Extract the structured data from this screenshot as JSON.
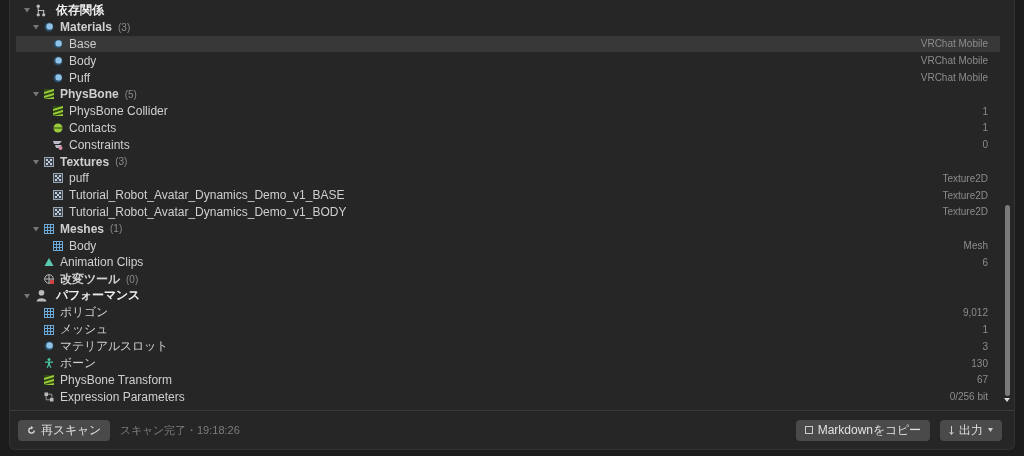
{
  "tree": [
    {
      "kind": "dependency",
      "label": "依存関係",
      "expanded": true,
      "selected": false,
      "children": [
        {
          "kind": "material",
          "label": "Materials",
          "count": "(3)",
          "expanded": true,
          "selected": false,
          "children": [
            {
              "kind": "material",
              "label": "Base",
              "value": "VRChat Mobile",
              "selected": true
            },
            {
              "kind": "material",
              "label": "Body",
              "value": "VRChat Mobile",
              "selected": false
            },
            {
              "kind": "material",
              "label": "Puff",
              "value": "VRChat Mobile",
              "selected": false
            }
          ]
        },
        {
          "kind": "physbone",
          "label": "PhysBone",
          "count": "(5)",
          "expanded": true,
          "selected": false,
          "children": [
            {
              "kind": "physbone",
              "label": "PhysBone Collider",
              "value": "1",
              "selected": false
            },
            {
              "kind": "contact",
              "label": "Contacts",
              "value": "1",
              "selected": false
            },
            {
              "kind": "constraint",
              "label": "Constraints",
              "value": "0",
              "selected": false
            }
          ]
        },
        {
          "kind": "texture",
          "label": "Textures",
          "count": "(3)",
          "expanded": true,
          "selected": false,
          "children": [
            {
              "kind": "texture",
              "label": "puff",
              "value": "Texture2D",
              "selected": false
            },
            {
              "kind": "texture",
              "label": "Tutorial_Robot_Avatar_Dynamics_Demo_v1_BASE",
              "value": "Texture2D",
              "selected": false
            },
            {
              "kind": "texture",
              "label": "Tutorial_Robot_Avatar_Dynamics_Demo_v1_BODY",
              "value": "Texture2D",
              "selected": false
            }
          ]
        },
        {
          "kind": "mesh",
          "label": "Meshes",
          "count": "(1)",
          "expanded": true,
          "selected": false,
          "children": [
            {
              "kind": "mesh",
              "label": "Body",
              "value": "Mesh",
              "selected": false
            }
          ]
        },
        {
          "kind": "animation",
          "label": "Animation Clips",
          "value": "6",
          "selected": false
        },
        {
          "kind": "tool",
          "label": "改変ツール",
          "count": "(0)",
          "selected": false
        }
      ]
    },
    {
      "kind": "performance",
      "label": "パフォーマンス",
      "expanded": true,
      "selected": false,
      "children": [
        {
          "kind": "mesh",
          "label": "ポリゴン",
          "value": "9,012",
          "selected": false
        },
        {
          "kind": "mesh",
          "label": "メッシュ",
          "value": "1",
          "selected": false
        },
        {
          "kind": "material",
          "label": "マテリアルスロット",
          "value": "3",
          "selected": false
        },
        {
          "kind": "bone",
          "label": "ボーン",
          "value": "130",
          "selected": false
        },
        {
          "kind": "physbone",
          "label": "PhysBone Transform",
          "value": "67",
          "selected": false
        },
        {
          "kind": "parameter",
          "label": "Expression Parameters",
          "value": "0/256 bit",
          "selected": false
        }
      ]
    }
  ],
  "footer": {
    "rescan": "再スキャン",
    "status": "スキャン完了・19:18:26",
    "copy": "Markdownをコピー",
    "export": "出力"
  }
}
